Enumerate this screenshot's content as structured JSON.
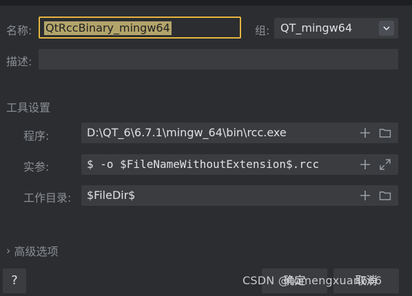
{
  "form": {
    "name_label": "名称:",
    "name_value": "QtRccBinary_mingw64",
    "group_label": "组:",
    "group_value": "QT_mingw64",
    "desc_label": "描述:",
    "desc_value": ""
  },
  "tool_settings": {
    "section_title": "工具设置",
    "program_label": "程序:",
    "program_value": "D:\\QT_6\\6.7.1\\mingw_64\\bin\\rcc.exe",
    "args_label": "实参:",
    "args_value": "$ -o $FileNameWithoutExtension$.rcc",
    "workdir_label": "工作目录:",
    "workdir_value": "$FileDir$"
  },
  "advanced": {
    "chevron": "›",
    "label": "高级选项"
  },
  "footer": {
    "help_label": "?",
    "ok_label": "确定",
    "cancel_label": "取消",
    "watermark": "CSDN @tomengxuan666"
  },
  "colors": {
    "accent_focus": "#e6b640",
    "background": "#2b2d30",
    "field": "#3a3c40"
  }
}
